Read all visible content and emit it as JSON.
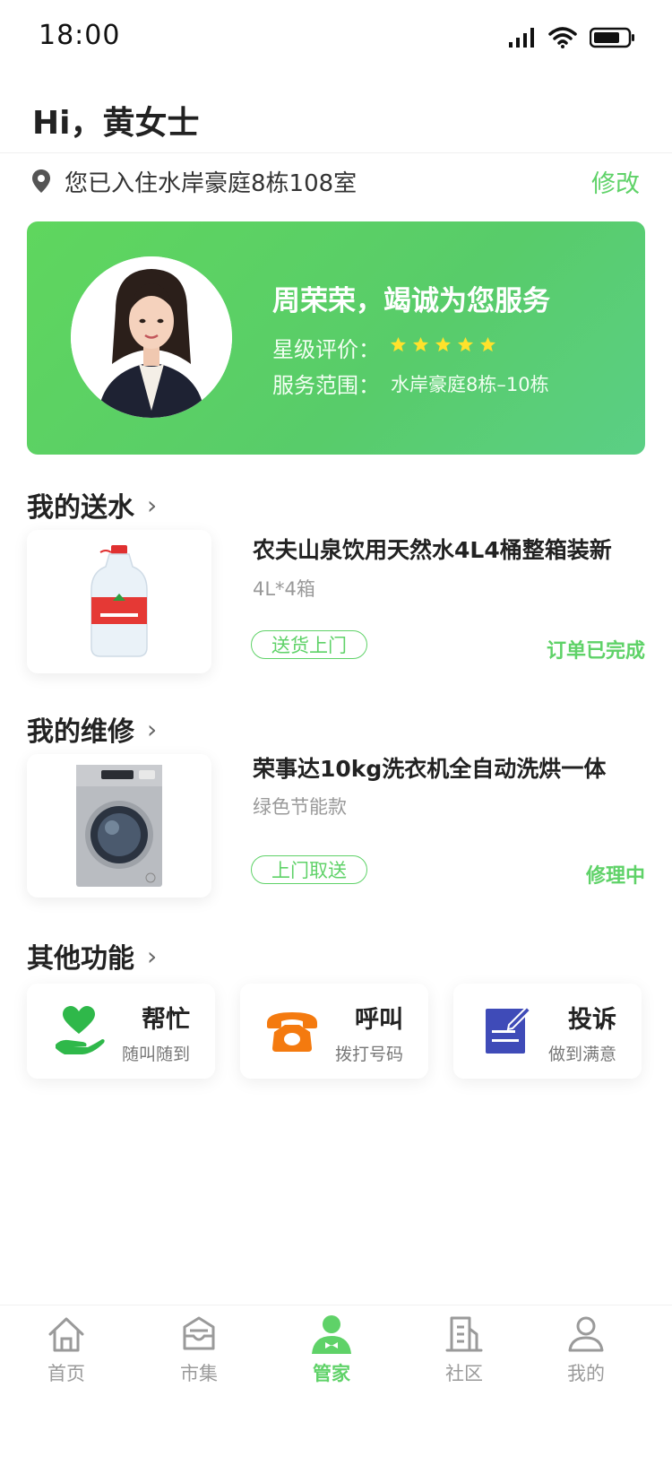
{
  "status_bar": {
    "time": "18:00"
  },
  "greeting": "Hi，黄女士",
  "address": {
    "text": "您已入住水岸豪庭8栋108室",
    "edit_label": "修改"
  },
  "butler": {
    "title": "周荣荣，竭诚为您服务",
    "rating_label": "星级评价：",
    "rating_value": 5,
    "range_label": "服务范围：",
    "range_value": "水岸豪庭8栋–10栋"
  },
  "water": {
    "section_title": "我的送水",
    "item_title": "农夫山泉饮用天然水4L4桶整箱装新",
    "item_sub": "4L*4箱",
    "tag": "送货上门",
    "status": "订单已完成"
  },
  "repair": {
    "section_title": "我的维修",
    "item_title": "荣事达10kg洗衣机全自动洗烘一体",
    "item_sub": "绿色节能款",
    "tag": "上门取送",
    "status": "修理中"
  },
  "other": {
    "section_title": "其他功能",
    "items": [
      {
        "name": "帮忙",
        "desc": "随叫随到",
        "icon": "helping-hand-heart-icon"
      },
      {
        "name": "呼叫",
        "desc": "拨打号码",
        "icon": "telephone-icon"
      },
      {
        "name": "投诉",
        "desc": "做到满意",
        "icon": "notepad-pen-icon"
      }
    ]
  },
  "tabs": [
    {
      "label": "首页",
      "icon": "home-icon"
    },
    {
      "label": "市集",
      "icon": "box-icon"
    },
    {
      "label": "管家",
      "icon": "butler-icon",
      "active": true
    },
    {
      "label": "社区",
      "icon": "building-icon"
    },
    {
      "label": "我的",
      "icon": "user-icon"
    }
  ],
  "colors": {
    "accent": "#5fd268",
    "card_gradient_start": "#5fd65e",
    "card_gradient_end": "#5bcf85"
  }
}
